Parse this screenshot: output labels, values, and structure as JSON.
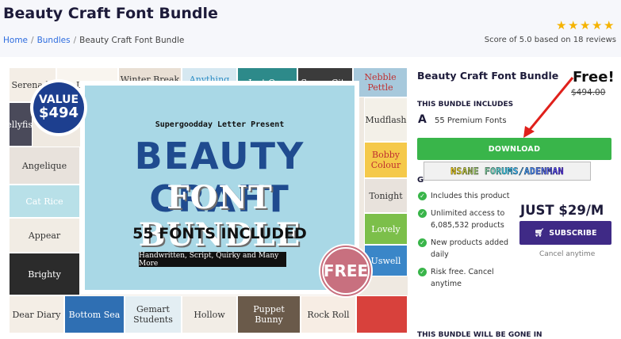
{
  "header": {
    "title": "Beauty Craft Font Bundle",
    "breadcrumb": [
      "Home",
      "Bundles",
      "Beauty Craft Font Bundle"
    ],
    "rating": 5,
    "score_text": "Score of 5.0 based on 18 reviews"
  },
  "hero": {
    "value_label": "VALUE",
    "value_amount": "$494",
    "presenter": "Supergoodday Letter Present",
    "title_line1": "BEAUTY CRAFT",
    "title_line2": "FONT BUNDLE",
    "fonts_included": "55 FONTS INCLUDED",
    "subtitle": "Handwritten, Script, Quirky and Many More",
    "free_badge": "FREE",
    "tiles": [
      "Serenade",
      "Land",
      "Winter Break",
      "Anything",
      "Just One",
      "Snoop City",
      "Nebble Pettle",
      "Jellyfish",
      "Mudflash",
      "Angelique",
      "Cat Rice",
      "Appear",
      "Brighty",
      "Bobby Colour",
      "Tonight",
      "Lovely",
      "Uswell",
      "Dear Diary",
      "Bottom Sea",
      "Gemart Students",
      "Hollow",
      "Puppet Bunny",
      "Rock Roll"
    ]
  },
  "sidebar": {
    "bundle_name": "Beauty Craft Font Bundle",
    "price_free": "Free!",
    "price_old": "$494.00",
    "includes_heading": "THIS BUNDLE INCLUDES",
    "font_glyph": "A",
    "font_count": "55 Premium Fonts",
    "download_label": "DOWNLOAD",
    "watermark": "NSANE FORUMS/ADENMAN",
    "partial_heading": "G",
    "benefits": [
      "Includes this product",
      "Unlimited access to 6,085,532 products",
      "New products added daily",
      "Risk free. Cancel anytime"
    ],
    "subscription_price": "JUST $29/M",
    "subscribe_label": "SUBSCRIBE",
    "cancel_note": "Cancel anytime",
    "gone_heading": "THIS BUNDLE WILL BE GONE IN"
  },
  "colors": {
    "download": "#39b54a",
    "subscribe": "#3f2a86",
    "star": "#f5b301",
    "title": "#1d1b3a",
    "arrow": "#e0201b"
  }
}
